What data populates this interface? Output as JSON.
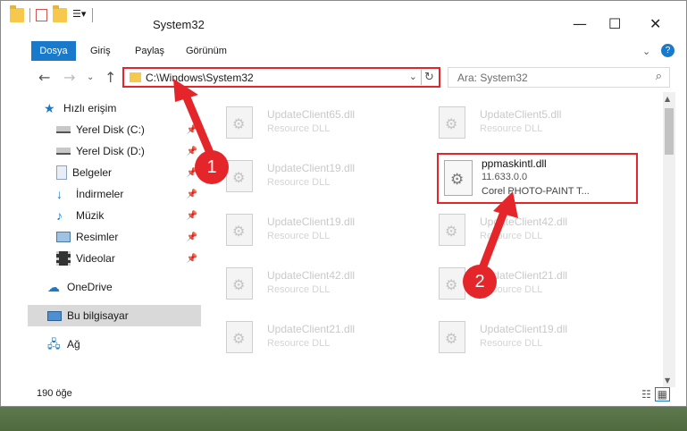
{
  "window": {
    "title": "System32",
    "min": "—",
    "max": "☐",
    "close": "✕"
  },
  "ribbon": {
    "file": "Dosya",
    "tabs": [
      "Giriş",
      "Paylaş",
      "Görünüm"
    ],
    "collapse": "⌄",
    "help": "?"
  },
  "nav": {
    "back": "←",
    "forward": "→",
    "recent": "⌄",
    "up": "↑"
  },
  "address": {
    "path": "C:\\Windows\\System32",
    "dropdown": "⌄",
    "refresh": "↻"
  },
  "search": {
    "placeholder": "Ara: System32",
    "icon": "search-icon"
  },
  "sidebar": {
    "items": [
      {
        "label": "Hızlı erişim",
        "icon": "star-icon",
        "pinned": false
      },
      {
        "label": "Yerel Disk (C:)",
        "icon": "drive-icon",
        "pinned": true
      },
      {
        "label": "Yerel Disk (D:)",
        "icon": "drive-icon",
        "pinned": true
      },
      {
        "label": "Belgeler",
        "icon": "document-icon",
        "pinned": true
      },
      {
        "label": "İndirmeler",
        "icon": "download-icon",
        "pinned": true
      },
      {
        "label": "Müzik",
        "icon": "music-icon",
        "pinned": true
      },
      {
        "label": "Resimler",
        "icon": "picture-icon",
        "pinned": true
      },
      {
        "label": "Videolar",
        "icon": "video-icon",
        "pinned": true
      },
      {
        "label": "OneDrive",
        "icon": "cloud-icon",
        "pinned": false
      },
      {
        "label": "Bu bilgisayar",
        "icon": "computer-icon",
        "pinned": false
      },
      {
        "label": "Ağ",
        "icon": "network-icon",
        "pinned": false
      }
    ]
  },
  "files": [
    {
      "name": "UpdateClient65.dll",
      "desc": "Resource DLL"
    },
    {
      "name": "UpdateClient5.dll",
      "desc": "Resource DLL"
    },
    {
      "name": "UpdateClient19.dll",
      "desc": "Resource DLL"
    },
    {
      "name": "UpdateClient19.dll",
      "desc": "Resource DLL"
    },
    {
      "name": "UpdateClient42.dll",
      "desc": "Resource DLL"
    },
    {
      "name": "UpdateClient42.dll",
      "desc": "Resource DLL"
    },
    {
      "name": "UpdateClient21.dll",
      "desc": "Resource DLL"
    },
    {
      "name": "UpdateClient21.dll",
      "desc": "Resource DLL"
    },
    {
      "name": "UpdateClient19.dll",
      "desc": "Resource DLL"
    }
  ],
  "highlighted": {
    "name": "ppmaskintl.dll",
    "version": "11.633.0.0",
    "company": "Corel PHOTO-PAINT T..."
  },
  "status": {
    "count": "190 öğe"
  },
  "annotations": {
    "badge1": "1",
    "badge2": "2",
    "color": "#e4262b"
  }
}
